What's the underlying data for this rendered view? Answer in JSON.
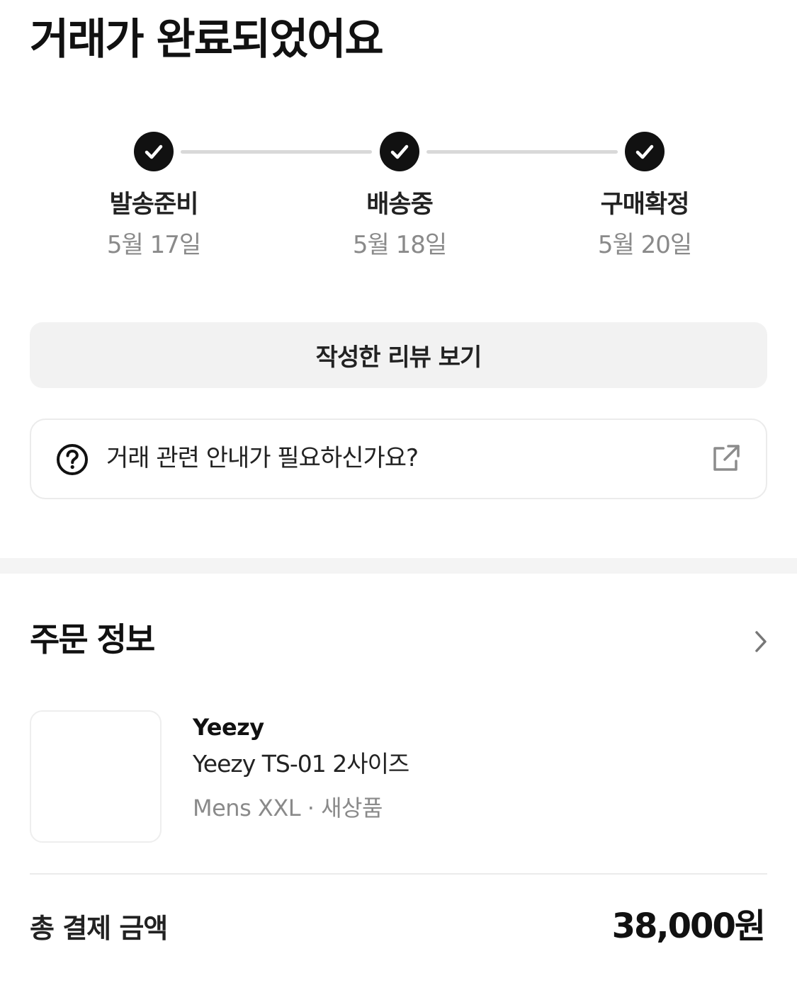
{
  "header": {
    "title": "거래가 완료되었어요"
  },
  "progress": {
    "steps": [
      {
        "label": "발송준비",
        "date": "5월 17일",
        "status_icon": "check-icon"
      },
      {
        "label": "배송중",
        "date": "5월 18일",
        "status_icon": "check-icon"
      },
      {
        "label": "구매확정",
        "date": "5월 20일",
        "status_icon": "check-icon"
      }
    ]
  },
  "actions": {
    "review_button_label": "작성한 리뷰 보기"
  },
  "help": {
    "text": "거래 관련 안내가 필요하신가요?",
    "leading_icon": "question-circle-icon",
    "trailing_icon": "external-link-icon"
  },
  "order": {
    "section_title": "주문 정보",
    "product": {
      "brand": "Yeezy",
      "name": "Yeezy TS-01 2사이즈",
      "option": "Mens XXL · 새상품"
    },
    "total": {
      "label": "총 결제 금액",
      "amount": "38,000원"
    }
  },
  "colors": {
    "text_primary": "#111111",
    "text_secondary": "#8a8a8a",
    "button_background": "#f2f2f2",
    "border": "#ebebeb",
    "progress_track": "#d9d9d9"
  }
}
